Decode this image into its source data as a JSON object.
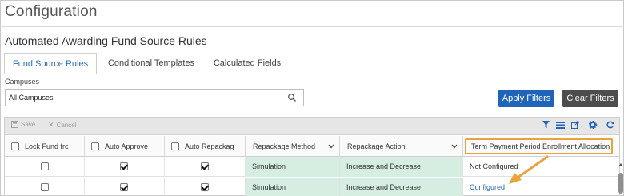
{
  "page": {
    "title": "Configuration",
    "subtitle": "Automated Awarding Fund Source Rules"
  },
  "tabs": [
    {
      "label": "Fund Source Rules",
      "active": true
    },
    {
      "label": "Conditional Templates",
      "active": false
    },
    {
      "label": "Calculated Fields",
      "active": false
    }
  ],
  "filters": {
    "campus_label": "Campuses",
    "campus_value": "All Campuses",
    "apply_label": "Apply Filters",
    "clear_label": "Clear Filters"
  },
  "toolbar": {
    "save_label": "Save",
    "cancel_label": "Cancel"
  },
  "columns": [
    {
      "label": "Lock Fund frc",
      "has_checkbox": true
    },
    {
      "label": "Auto Approve",
      "has_checkbox": true
    },
    {
      "label": "Auto Repackag",
      "has_checkbox": true
    },
    {
      "label": "Repackage Method",
      "has_checkbox": false
    },
    {
      "label": "Repackage Action",
      "has_checkbox": false
    },
    {
      "label": "Term Payment Period Enrollment Allocation",
      "has_checkbox": false
    }
  ],
  "rows": [
    {
      "lock": false,
      "auto_approve": true,
      "auto_repackage": true,
      "method": "Simulation",
      "action": "Increase and Decrease",
      "allocation": "Not Configured"
    },
    {
      "lock": false,
      "auto_approve": true,
      "auto_repackage": true,
      "method": "Simulation",
      "action": "Increase and Decrease",
      "allocation": "Configured"
    }
  ],
  "colors": {
    "primary": "#1f64b8",
    "secondary": "#4d4d4d",
    "highlight": "#e8a33c",
    "green_cell": "#d6ede1"
  }
}
